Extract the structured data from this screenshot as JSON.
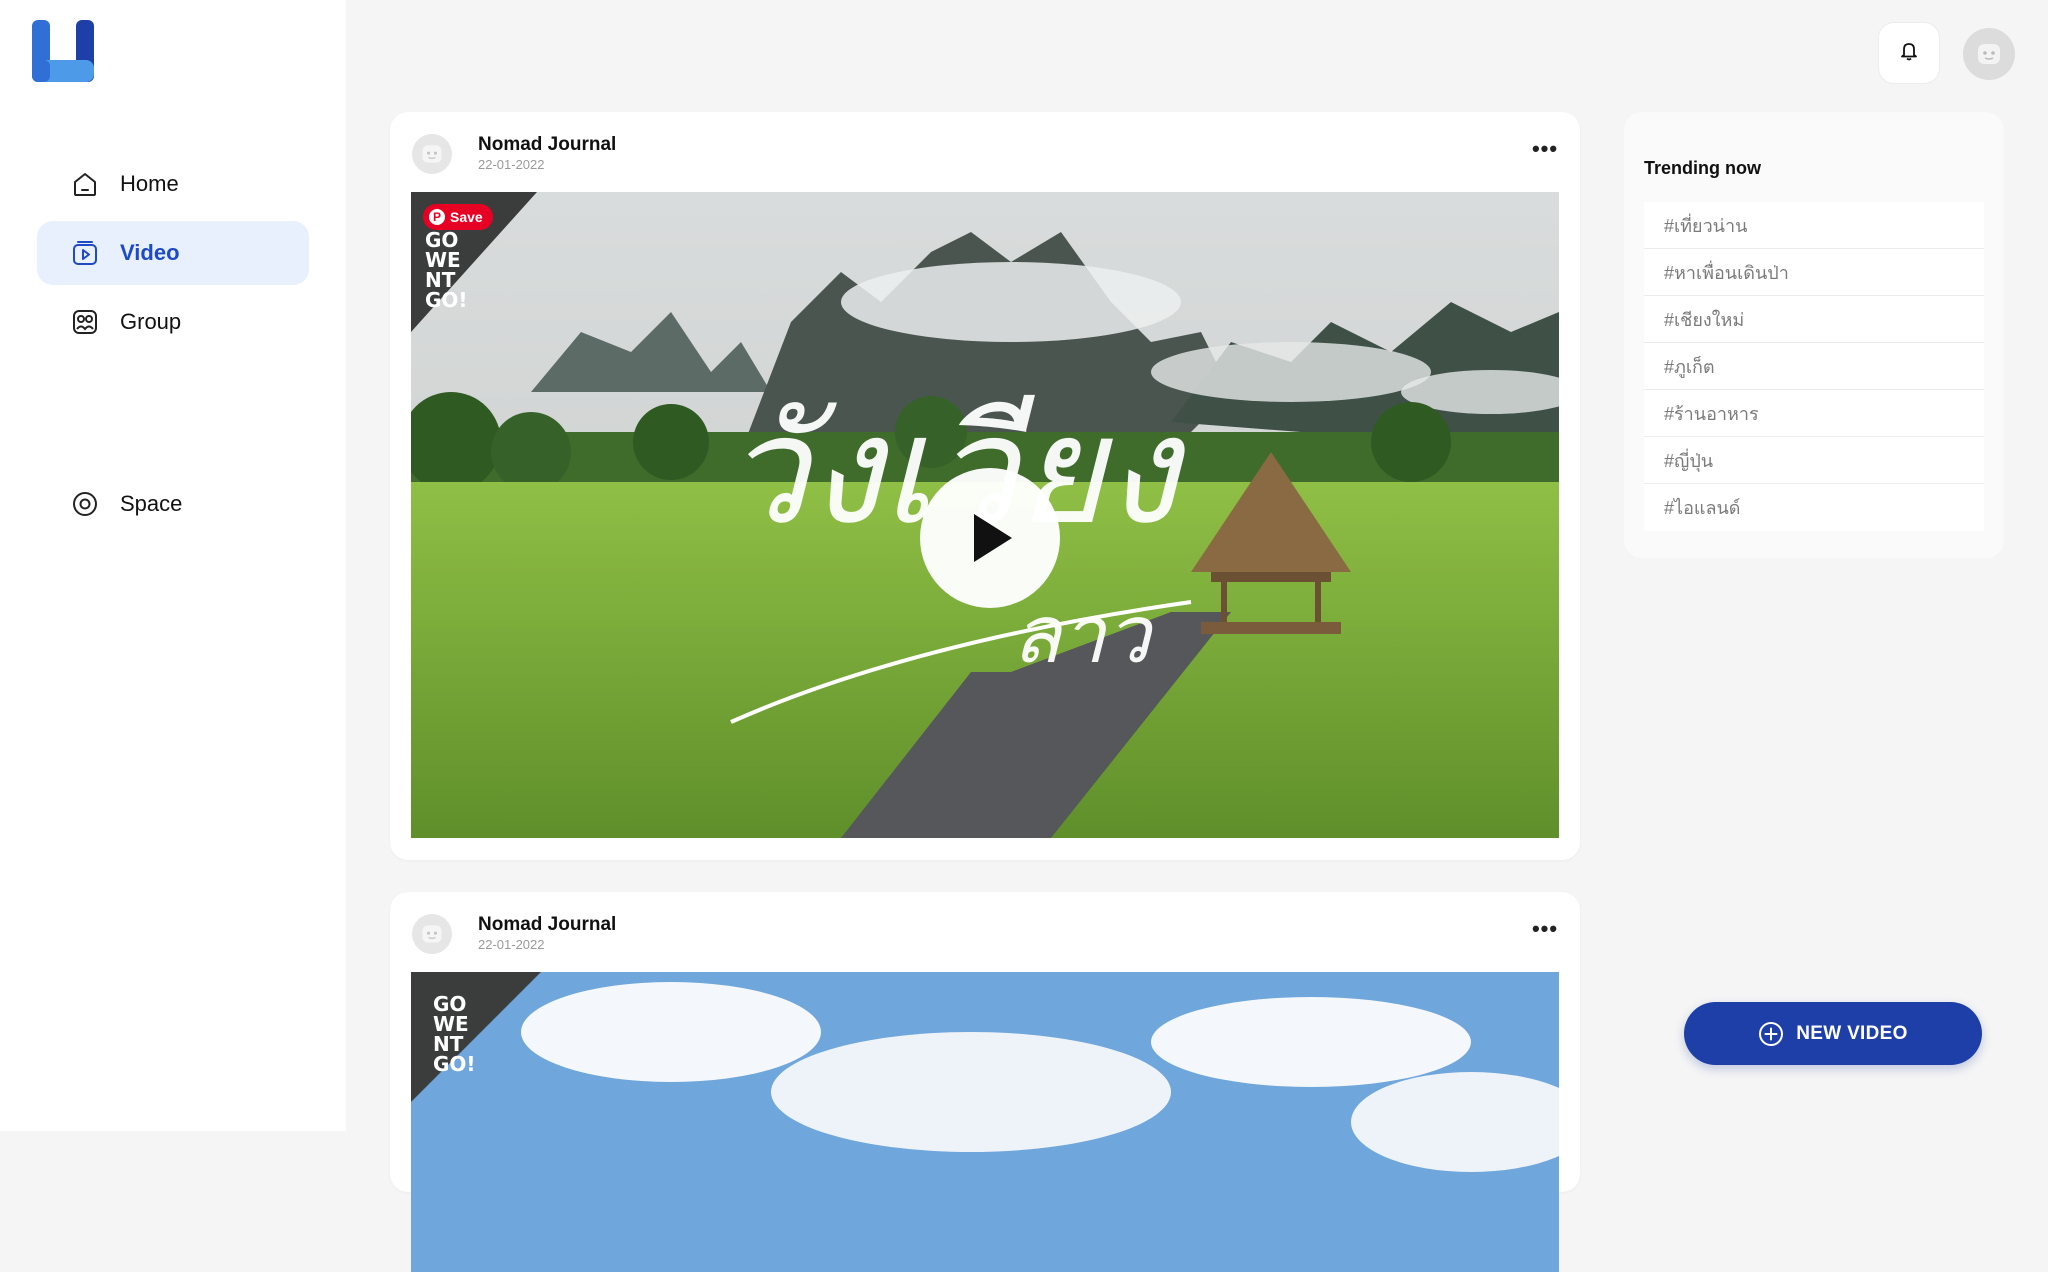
{
  "colors": {
    "accent": "#1e3fa8",
    "active_bg": "#e7f0fc",
    "active_text": "#1e4ac6",
    "pinterest": "#e60023"
  },
  "sidebar": {
    "items": [
      {
        "label": "Home",
        "icon": "home-icon"
      },
      {
        "label": "Video",
        "icon": "video-icon",
        "active": true
      },
      {
        "label": "Group",
        "icon": "group-icon"
      },
      {
        "label": "Space",
        "icon": "space-icon"
      }
    ]
  },
  "header": {
    "bell_icon": "bell-icon",
    "avatar_icon": "user-avatar"
  },
  "posts": [
    {
      "author": "Nomad Journal",
      "date": "22-01-2022",
      "save_label": "Save",
      "title_overlay": "วังเวียง ลาว",
      "brand": "GO WENT GO!"
    },
    {
      "author": "Nomad Journal",
      "date": "22-01-2022",
      "brand": "GO WENT GO!"
    }
  ],
  "trending": {
    "title": "Trending now",
    "tags": [
      "#เที่ยวน่าน",
      "#หาเพื่อนเดินป่า",
      "#เชียงใหม่",
      "#ภูเก็ต",
      "#ร้านอาหาร",
      "#ญี่ปุ่น",
      "#ไอแลนด์"
    ]
  },
  "actions": {
    "new_video_label": "NEW VIDEO"
  }
}
